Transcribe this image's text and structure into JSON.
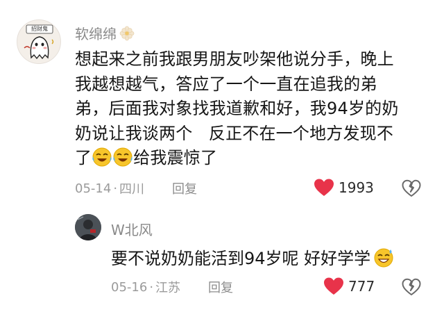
{
  "colors": {
    "heart": "#e8334a",
    "meta_text": "#9a9a9a",
    "username_text": "#8a8a8a",
    "body_text": "#161616"
  },
  "comment": {
    "avatar_label": "招财鬼",
    "username": "软绵绵",
    "username_icon": "flower-icon",
    "lines": [
      "想起来之前我跟男朋友吵架他说分手，晚上",
      "我越想越气，答应了一个一直在追我的弟",
      "弟，后面我对象找我道歉和好，我94岁的奶",
      "奶说让我谈两个   反正不在一个地方发现不"
    ],
    "last_line_prefix": "了",
    "last_line_emoji": "laughing-crying-emoji",
    "last_line_suffix": "给我震惊了",
    "date": "05-14",
    "separator": "·",
    "location": "四川",
    "reply_label": "回复",
    "like_count": "1993"
  },
  "reply": {
    "username": "W北风",
    "text": "要不说奶奶能活到94岁呢 好好学学",
    "emoji": "sweat-smile-emoji",
    "date": "05-16",
    "separator": "·",
    "location": "江苏",
    "reply_label": "回复",
    "like_count": "777"
  }
}
